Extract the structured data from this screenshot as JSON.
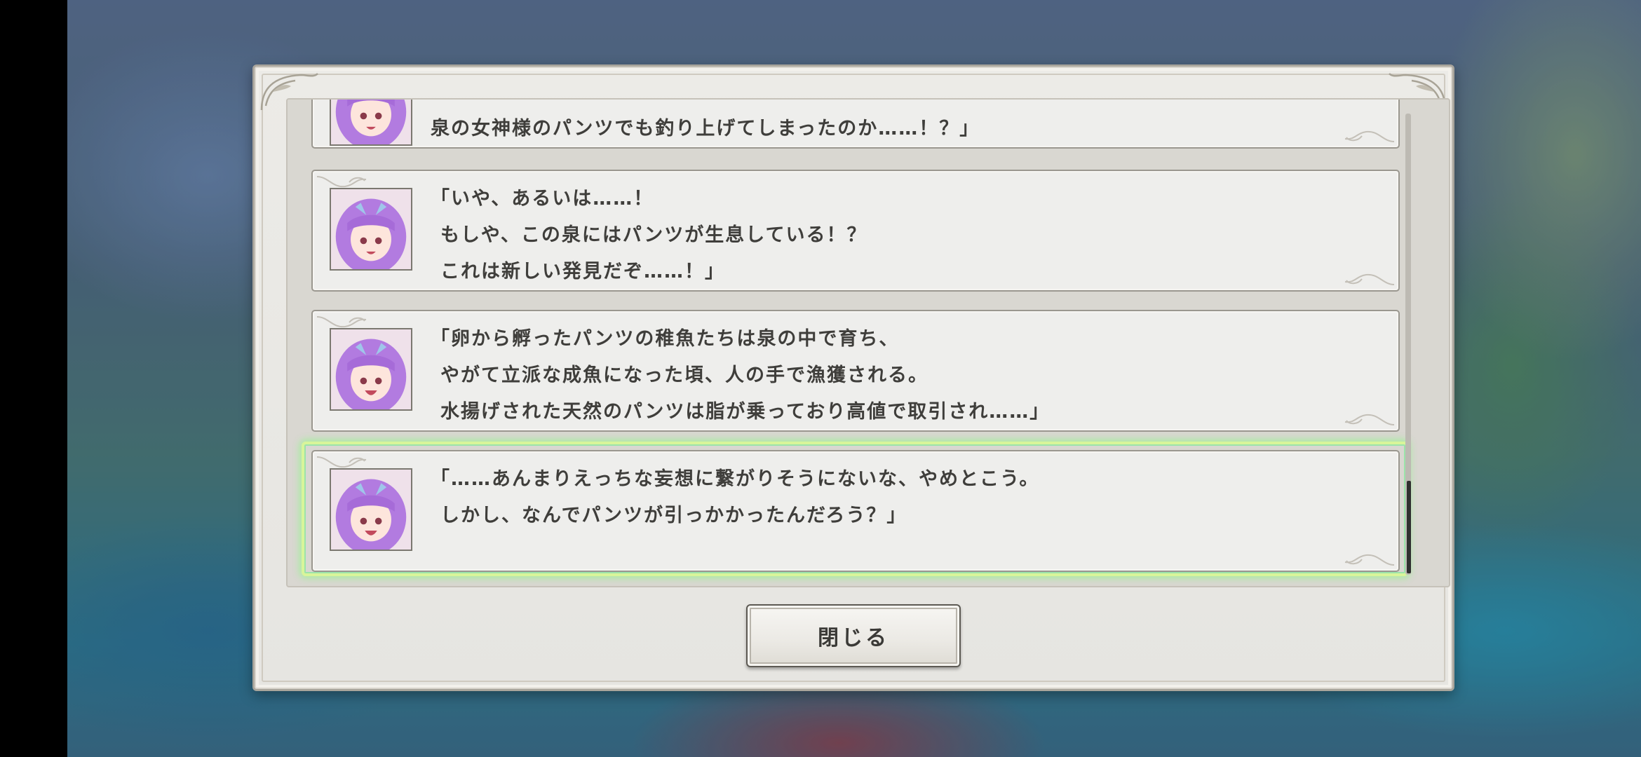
{
  "log": {
    "entries": [
      {
        "speaker_icon": "purple-haired-girl-portrait",
        "lines": [
          "泉の女神様のパンツでも釣り上げてしまったのか……！？」"
        ],
        "highlighted": false
      },
      {
        "speaker_icon": "purple-haired-girl-portrait",
        "lines": [
          "「いや、あるいは……！",
          "もしや、この泉にはパンツが生息している！？",
          "これは新しい発見だぞ……！」"
        ],
        "highlighted": false
      },
      {
        "speaker_icon": "purple-haired-girl-portrait",
        "lines": [
          "「卵から孵ったパンツの稚魚たちは泉の中で育ち、",
          "やがて立派な成魚になった頃、人の手で漁獲される。",
          "水揚げされた天然のパンツは脂が乗っており高値で取引され……」"
        ],
        "highlighted": false
      },
      {
        "speaker_icon": "purple-haired-girl-portrait",
        "lines": [
          "「……あんまりえっちな妄想に繋がりそうにないな、やめとこう。",
          "しかし、なんでパンツが引っかかったんだろう？」"
        ],
        "highlighted": true
      }
    ],
    "highlight_color": "#c9f08a"
  },
  "close_button": {
    "label": "閉じる"
  }
}
